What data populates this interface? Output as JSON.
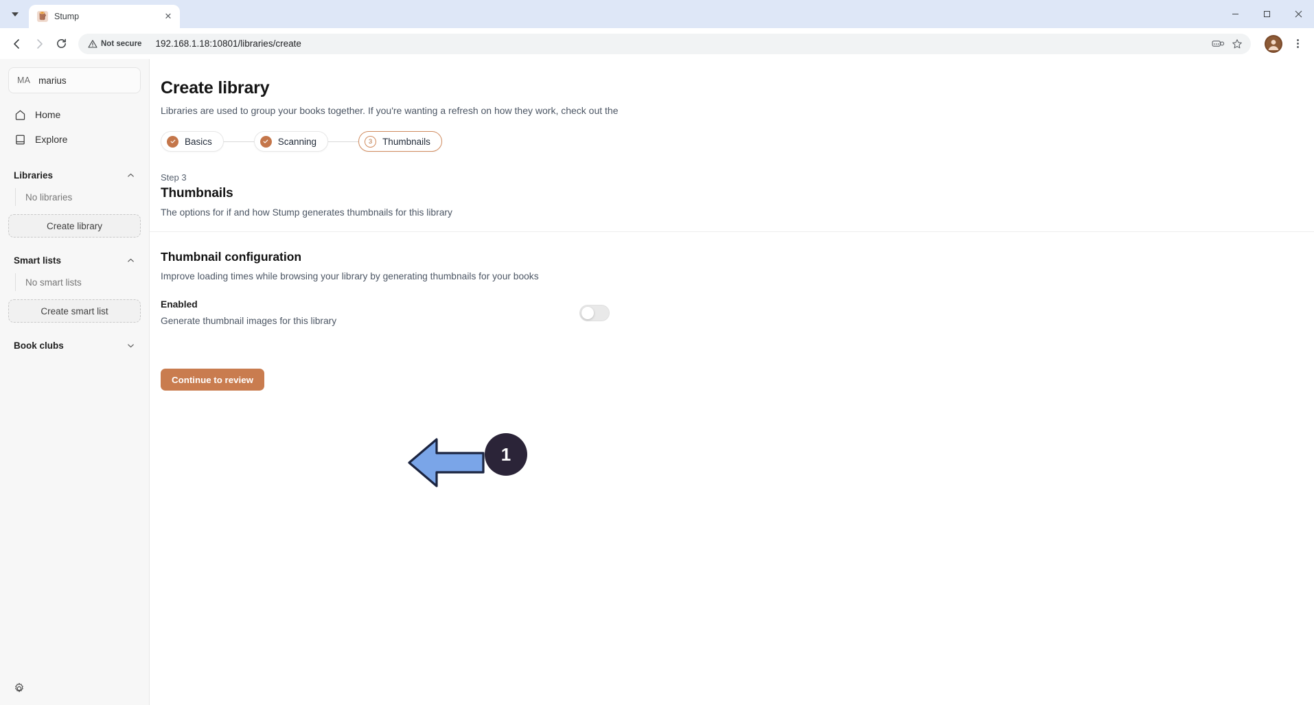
{
  "browser": {
    "tab": {
      "title": "Stump",
      "favicon_icon": "stump-favicon",
      "close_icon": "close-icon"
    },
    "tab_search_icon": "chevron-down-icon",
    "window": {
      "minimize": "—",
      "maximize": "▢",
      "close": "✕"
    },
    "nav": {
      "back_icon": "arrow-left-icon",
      "forward_icon": "arrow-right-icon",
      "reload_icon": "reload-icon"
    },
    "omnibox": {
      "security_label": "Not secure",
      "security_icon": "warning-triangle-icon",
      "url": "192.168.1.18:10801/libraries/create",
      "passkey_icon": "passkey-icon",
      "bookmark_icon": "star-icon"
    },
    "profile_icon": "avatar",
    "menu_icon": "three-dots-menu-icon"
  },
  "sidebar": {
    "user": {
      "initials": "MA",
      "name": "marius"
    },
    "nav_items": [
      {
        "label": "Home",
        "icon": "home-icon"
      },
      {
        "label": "Explore",
        "icon": "book-icon"
      }
    ],
    "sections": [
      {
        "title": "Libraries",
        "chevron": "chevron-up-icon",
        "empty_text": "No libraries",
        "action_label": "Create library"
      },
      {
        "title": "Smart lists",
        "chevron": "chevron-up-icon",
        "empty_text": "No smart lists",
        "action_label": "Create smart list"
      },
      {
        "title": "Book clubs",
        "chevron": "chevron-down-icon",
        "empty_text": "",
        "action_label": ""
      }
    ],
    "settings_icon": "gear-icon"
  },
  "main": {
    "title": "Create library",
    "subtitle": "Libraries are used to group your books together. If you're wanting a refresh on how they work, check out the",
    "stepper": [
      {
        "label": "Basics",
        "badge": "✓",
        "state": "done"
      },
      {
        "label": "Scanning",
        "badge": "✓",
        "state": "done"
      },
      {
        "label": "Thumbnails",
        "badge": "3",
        "state": "current"
      }
    ],
    "step_eyebrow": "Step 3",
    "step_title": "Thumbnails",
    "step_desc": "The options for if and how Stump generates thumbnails for this library",
    "config": {
      "title": "Thumbnail configuration",
      "desc": "Improve loading times while browsing your library by generating thumbnails for your books",
      "toggle": {
        "label": "Enabled",
        "desc": "Generate thumbnail images for this library",
        "state": "off"
      }
    },
    "primary_button": "Continue to review"
  },
  "annotation": {
    "step_number": "1",
    "arrow_direction": "left",
    "arrow_color": "#7aa5e8",
    "badge_color": "#2b2438"
  },
  "colors": {
    "accent": "#c97c4f",
    "sidebar_bg": "#f7f7f7",
    "page_bg": "#ffffff"
  }
}
